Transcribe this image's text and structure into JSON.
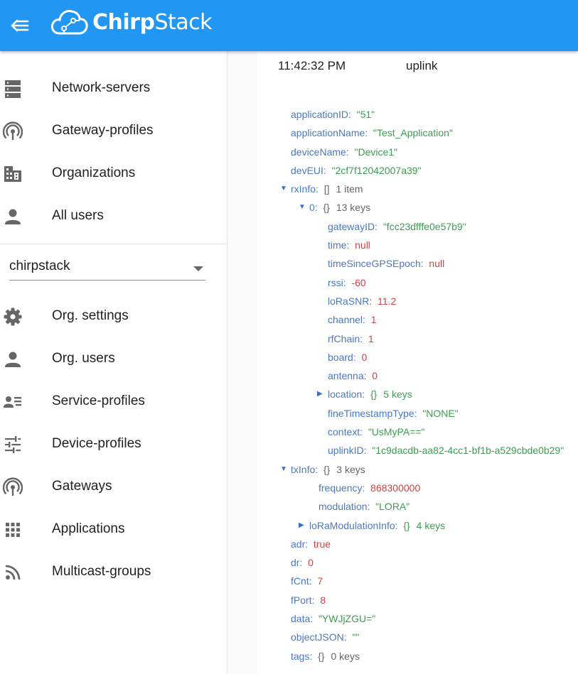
{
  "header": {
    "brand_a": "Chirp",
    "brand_b": "Stack"
  },
  "sidebar": {
    "items_top": [
      {
        "label": "Network-servers",
        "icon": "server-icon"
      },
      {
        "label": "Gateway-profiles",
        "icon": "broadcast-icon"
      },
      {
        "label": "Organizations",
        "icon": "domain-icon"
      },
      {
        "label": "All users",
        "icon": "person-icon"
      }
    ],
    "org": "chirpstack",
    "items_org": [
      {
        "label": "Org. settings",
        "icon": "gear-icon"
      },
      {
        "label": "Org. users",
        "icon": "person-icon"
      },
      {
        "label": "Service-profiles",
        "icon": "account-details-icon"
      },
      {
        "label": "Device-profiles",
        "icon": "tune-icon"
      },
      {
        "label": "Gateways",
        "icon": "broadcast-icon"
      },
      {
        "label": "Applications",
        "icon": "apps-grid-icon"
      },
      {
        "label": "Multicast-groups",
        "icon": "rss-icon"
      }
    ]
  },
  "event": {
    "time": "11:42:32 PM",
    "type": "uplink"
  },
  "json_rows": [
    {
      "indent": 0,
      "key": "applicationID",
      "val": "\"51\"",
      "t": "s"
    },
    {
      "indent": 0,
      "key": "applicationName",
      "val": "\"Test_Application\"",
      "t": "s"
    },
    {
      "indent": 0,
      "key": "deviceName",
      "val": "\"Device1\"",
      "t": "s"
    },
    {
      "indent": 0,
      "key": "devEUI",
      "val": "\"2cf7f12042007a39\"",
      "t": "s"
    },
    {
      "indent": 0,
      "key": "rxInfo",
      "val": "[]",
      "t": "meta",
      "extra": "1 item",
      "arrow": "open"
    },
    {
      "indent": 1,
      "key": "0",
      "val": "{}",
      "t": "meta",
      "extra": "13 keys",
      "arrow": "open"
    },
    {
      "indent": 2,
      "key": "gatewayID",
      "val": "\"fcc23dfffe0e57b9\"",
      "t": "s"
    },
    {
      "indent": 2,
      "key": "time",
      "val": "null",
      "t": "n"
    },
    {
      "indent": 2,
      "key": "timeSinceGPSEpoch",
      "val": "null",
      "t": "n"
    },
    {
      "indent": 2,
      "key": "rssi",
      "val": "-60",
      "t": "n"
    },
    {
      "indent": 2,
      "key": "loRaSNR",
      "val": "11.2",
      "t": "n"
    },
    {
      "indent": 2,
      "key": "channel",
      "val": "1",
      "t": "n"
    },
    {
      "indent": 2,
      "key": "rfChain",
      "val": "1",
      "t": "n"
    },
    {
      "indent": 2,
      "key": "board",
      "val": "0",
      "t": "n"
    },
    {
      "indent": 2,
      "key": "antenna",
      "val": "0",
      "t": "n"
    },
    {
      "indent": 2,
      "key": "location",
      "val": "{}",
      "t": "s",
      "extra": "5 keys",
      "arrow": "closed"
    },
    {
      "indent": 2,
      "key": "fineTimestampType",
      "val": "\"NONE\"",
      "t": "s"
    },
    {
      "indent": 2,
      "key": "context",
      "val": "\"UsMyPA==\"",
      "t": "s"
    },
    {
      "indent": 2,
      "key": "uplinkID",
      "val": "\"1c9dacdb-aa82-4cc1-bf1b-a529cbde0b29\"",
      "t": "s"
    },
    {
      "indent": 0,
      "key": "txInfo",
      "val": "{}",
      "t": "meta",
      "extra": "3 keys",
      "arrow": "open"
    },
    {
      "indent": 1.5,
      "key": "frequency",
      "val": "868300000",
      "t": "n"
    },
    {
      "indent": 1.5,
      "key": "modulation",
      "val": "\"LORA\"",
      "t": "s"
    },
    {
      "indent": 1,
      "key": "loRaModulationInfo",
      "val": "{}",
      "t": "s",
      "extra": "4 keys",
      "arrow": "closed"
    },
    {
      "indent": 0,
      "key": "adr",
      "val": "true",
      "t": "b"
    },
    {
      "indent": 0,
      "key": "dr",
      "val": "0",
      "t": "n"
    },
    {
      "indent": 0,
      "key": "fCnt",
      "val": "7",
      "t": "n"
    },
    {
      "indent": 0,
      "key": "fPort",
      "val": "8",
      "t": "n"
    },
    {
      "indent": 0,
      "key": "data",
      "val": "\"YWJjZGU=\"",
      "t": "s"
    },
    {
      "indent": 0,
      "key": "objectJSON",
      "val": "\"\"",
      "t": "s"
    },
    {
      "indent": 0,
      "key": "tags",
      "val": "{}",
      "t": "meta",
      "extra": "0 keys"
    }
  ],
  "colors": {
    "appbar": "#2196f3",
    "key": "#4a78c2",
    "string": "#3d9b52",
    "number": "#d1433f"
  }
}
